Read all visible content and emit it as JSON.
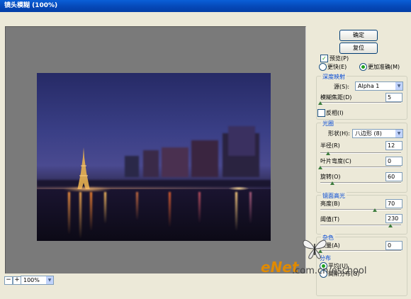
{
  "window": {
    "title": "镜头模糊 (100%)"
  },
  "buttons": {
    "ok": "确定",
    "reset": "复位"
  },
  "preview": {
    "label": "预览(P)",
    "checked": true,
    "faster": "更快(E)",
    "more_accurate": "更加准确(M)",
    "selected": "more_accurate"
  },
  "depth_map": {
    "header": "深度映射",
    "source_label": "源(S):",
    "source_value": "Alpha 1",
    "blur_focal_label": "模糊焦距(D)",
    "blur_focal_value": "5",
    "invert_label": "反相(I)",
    "invert_checked": false
  },
  "iris": {
    "header": "光圈",
    "shape_label": "形状(H):",
    "shape_value": "八边形 (8)",
    "radius_label": "半径(R)",
    "radius_value": "12",
    "curvature_label": "叶片弯度(C)",
    "curvature_value": "0",
    "rotation_label": "旋转(O)",
    "rotation_value": "60"
  },
  "specular": {
    "header": "镜面高光",
    "brightness_label": "亮度(B)",
    "brightness_value": "70",
    "threshold_label": "阈值(T)",
    "threshold_value": "230"
  },
  "noise": {
    "header": "杂色",
    "amount_label": "数量(A)",
    "amount_value": "0",
    "distribution_header": "分布",
    "uniform_label": "平均(U)",
    "gaussian_label": "高斯分布(G)"
  },
  "zoom": {
    "minus": "−",
    "plus": "+",
    "value": "100%"
  },
  "watermark": {
    "brand": "eNet",
    "url": ".com.cn/eschool"
  },
  "colors": {
    "title_bar": "#0548b8",
    "group_header": "#0046d5",
    "dialog_bg": "#ece9d8"
  }
}
